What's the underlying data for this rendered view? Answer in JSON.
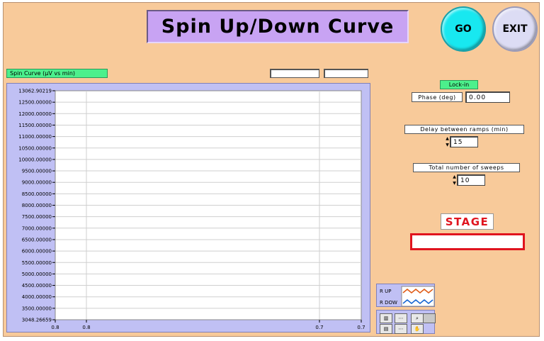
{
  "title": "Spin Up/Down Curve",
  "buttons": {
    "go": "GO",
    "exit": "EXIT"
  },
  "chart_label": "Spin Curve (μV vs min)",
  "chart_data": {
    "type": "line",
    "y_ticks": [
      "13062.90219",
      "12500.00000",
      "12000.00000",
      "11500.00000",
      "11000.00000",
      "10500.00000",
      "10000.00000",
      "9500.00000",
      "9000.00000",
      "8500.00000",
      "8000.00000",
      "7500.00000",
      "7000.00000",
      "6500.00000",
      "6000.00000",
      "5500.00000",
      "5000.00000",
      "4500.00000",
      "4000.00000",
      "3500.00000",
      "3048.26659"
    ],
    "x_ticks": [
      "0.8",
      "0.8",
      "0.7",
      "0.7"
    ],
    "ylim": [
      3048.26659,
      13062.90219
    ],
    "grid": true,
    "legend": [
      "R UP",
      "R DOW"
    ],
    "colors": {
      "up": "#e05a14",
      "down": "#1464d2"
    }
  },
  "lockin": {
    "label": "Lock-in",
    "phase_label": "Phase (deg)",
    "phase_value": "0.00"
  },
  "delay": {
    "label": "Delay between ramps (min)",
    "value": "15"
  },
  "sweeps": {
    "label": "Total number of sweeps",
    "value": "10"
  },
  "stage": {
    "label": "STAGE",
    "value": ""
  },
  "colors": {
    "panel": "#f8ca9a",
    "title_bg": "#c8a3f3",
    "go": "#18e8f0",
    "exit": "#dcdcf4",
    "plot_frame": "#c0c0f4",
    "stage": "#e0141e"
  }
}
